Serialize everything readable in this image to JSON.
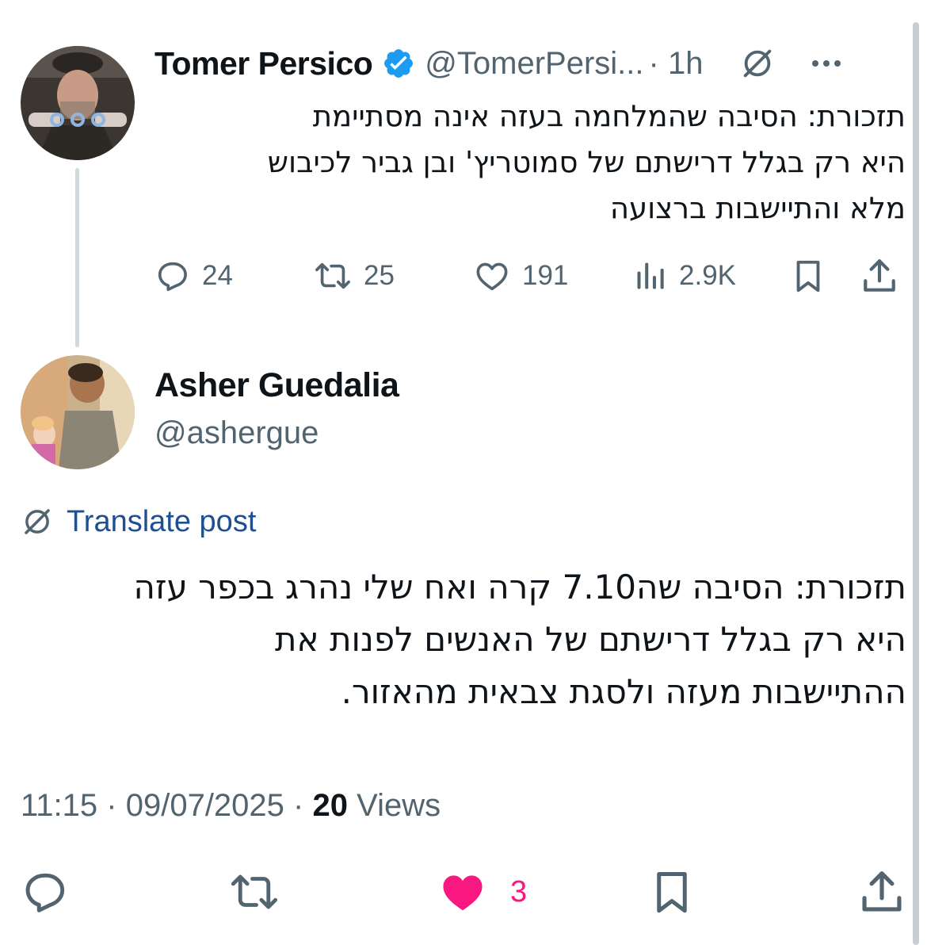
{
  "parent_tweet": {
    "name": "Tomer Persico",
    "handle": "@TomerPersi...",
    "time": "· 1h",
    "text_lines": [
      "תזכורת: הסיבה שהמלחמה בעזה אינה מסתיימת",
      "היא רק בגלל דרישתם של סמוטריץ' ובן גביר לכיבוש",
      "מלא והתיישבות ברצועה"
    ],
    "actions": {
      "replies": "24",
      "reposts": "25",
      "likes": "191",
      "views": "2.9K"
    },
    "icons": [
      "verified-badge-icon",
      "translate-icon",
      "more-icon",
      "reply-icon",
      "repost-icon",
      "like-icon",
      "views-icon",
      "bookmark-icon",
      "share-icon"
    ]
  },
  "main_tweet": {
    "name": "Asher Guedalia",
    "handle": "@ashergue",
    "translate_label": "Translate post",
    "text_lines": [
      "תזכורת: הסיבה שה7.10 קרה ואח שלי נהרג בכפר עזה",
      "היא רק בגלל דרישתם של האנשים לפנות את",
      "ההתיישבות מעזה ולסגת צבאית מהאזור."
    ],
    "meta": {
      "time": "11:15",
      "separator": "·",
      "date": "09/07/2025",
      "views_count": "20",
      "views_label": "Views"
    },
    "actions": {
      "likes": "3"
    }
  },
  "colors": {
    "text": "#0f1419",
    "secondary": "#536471",
    "like_pink": "#f91880",
    "verified_blue": "#1d9bf0",
    "translate_link": "#1d4f91",
    "thread_line": "#cfd9de"
  }
}
